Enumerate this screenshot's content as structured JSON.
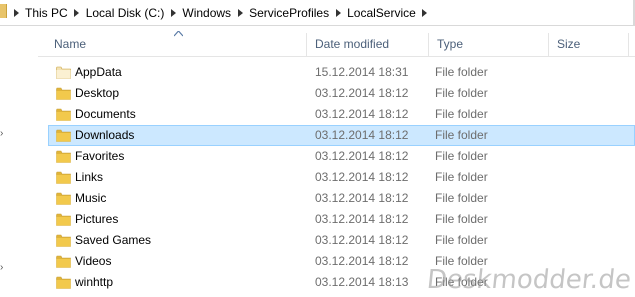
{
  "breadcrumb": [
    "This PC",
    "Local Disk (C:)",
    "Windows",
    "ServiceProfiles",
    "LocalService"
  ],
  "columns": {
    "name": "Name",
    "date": "Date modified",
    "type": "Type",
    "size": "Size"
  },
  "files": [
    {
      "name": "AppData",
      "date": "15.12.2014 18:31",
      "type": "File folder",
      "icon": "folder-light-icon",
      "selected": false
    },
    {
      "name": "Desktop",
      "date": "03.12.2014 18:12",
      "type": "File folder",
      "icon": "folder-icon",
      "selected": false
    },
    {
      "name": "Documents",
      "date": "03.12.2014 18:12",
      "type": "File folder",
      "icon": "folder-icon",
      "selected": false
    },
    {
      "name": "Downloads",
      "date": "03.12.2014 18:12",
      "type": "File folder",
      "icon": "folder-icon",
      "selected": true
    },
    {
      "name": "Favorites",
      "date": "03.12.2014 18:12",
      "type": "File folder",
      "icon": "folder-icon",
      "selected": false
    },
    {
      "name": "Links",
      "date": "03.12.2014 18:12",
      "type": "File folder",
      "icon": "folder-icon",
      "selected": false
    },
    {
      "name": "Music",
      "date": "03.12.2014 18:12",
      "type": "File folder",
      "icon": "folder-icon",
      "selected": false
    },
    {
      "name": "Pictures",
      "date": "03.12.2014 18:12",
      "type": "File folder",
      "icon": "folder-icon",
      "selected": false
    },
    {
      "name": "Saved Games",
      "date": "03.12.2014 18:12",
      "type": "File folder",
      "icon": "folder-icon",
      "selected": false
    },
    {
      "name": "Videos",
      "date": "03.12.2014 18:12",
      "type": "File folder",
      "icon": "folder-icon",
      "selected": false
    },
    {
      "name": "winhttp",
      "date": "03.12.2014 18:13",
      "type": "File folder",
      "icon": "folder-icon",
      "selected": false
    }
  ],
  "watermark": "Deskmodder.de",
  "colors": {
    "selection_bg": "#cce8ff",
    "selection_border": "#99d1ff",
    "header_text": "#4c607a",
    "meta_text": "#6d6d6d",
    "folder": "#f2c94c"
  }
}
